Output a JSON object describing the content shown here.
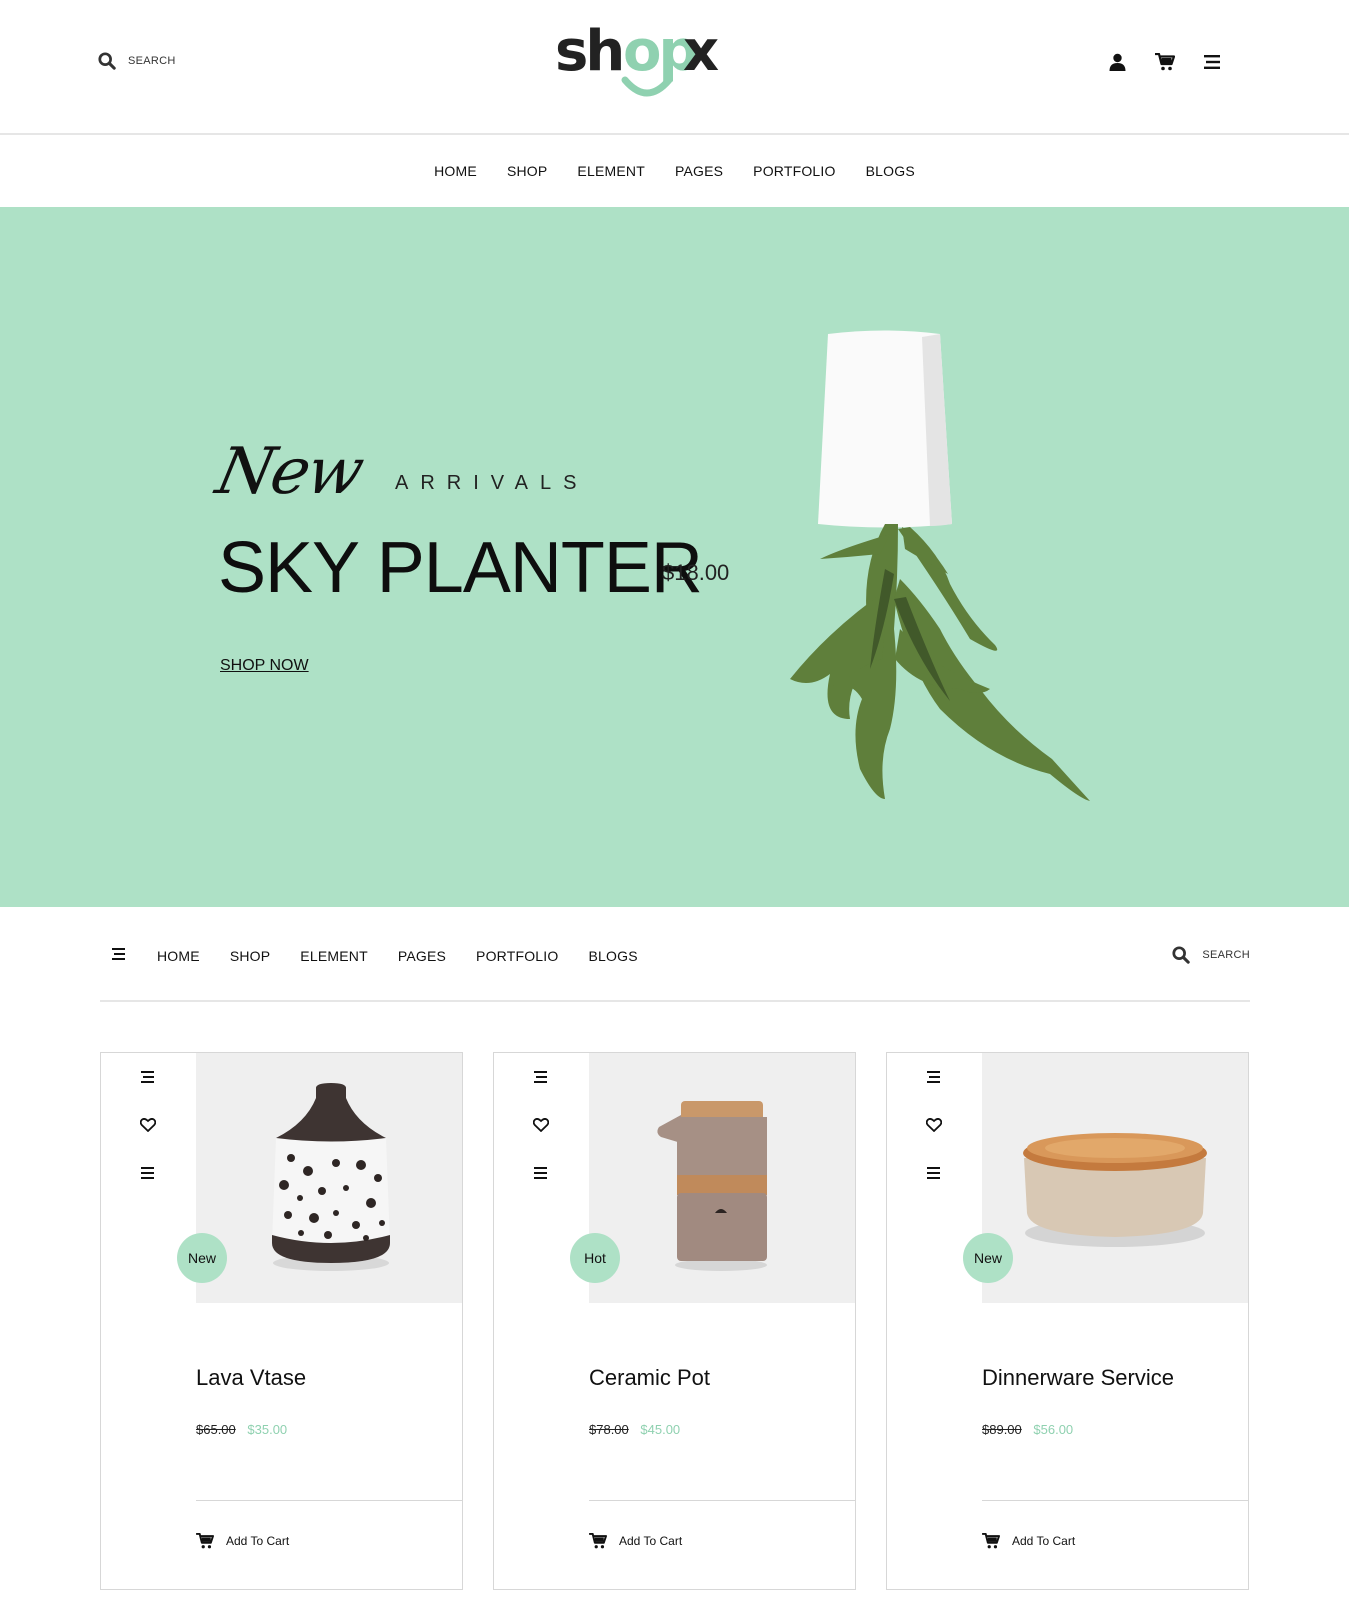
{
  "header": {
    "search_label": "SEARCH",
    "logo_text": "shopx",
    "icons": [
      "user-icon",
      "cart-icon",
      "menu-icon"
    ]
  },
  "main_nav": [
    "HOME",
    "SHOP",
    "ELEMENT",
    "PAGES",
    "PORTFOLIO",
    "BLOGS"
  ],
  "hero": {
    "script_word": "New",
    "tagline": "ARRIVALS",
    "title": "SKY PLANTER",
    "price": "$18.00",
    "cta": "SHOP NOW",
    "background": "#aee1c6"
  },
  "sub_nav": {
    "items": [
      "HOME",
      "SHOP",
      "ELEMENT",
      "PAGES",
      "PORTFOLIO",
      "BLOGS"
    ],
    "search_label": "SEARCH"
  },
  "products": [
    {
      "badge": "New",
      "name": "Lava Vtase",
      "old_price": "$65.00",
      "price": "$35.00",
      "cart_label": "Add To Cart"
    },
    {
      "badge": "Hot",
      "name": "Ceramic Pot",
      "old_price": "$78.00",
      "price": "$45.00",
      "cart_label": "Add To Cart"
    },
    {
      "badge": "New",
      "name": "Dinnerware Service",
      "old_price": "$89.00",
      "price": "$56.00",
      "cart_label": "Add To Cart"
    }
  ],
  "colors": {
    "accent": "#aee1c6",
    "sale_price": "#8fd1b0",
    "text": "#111111"
  }
}
